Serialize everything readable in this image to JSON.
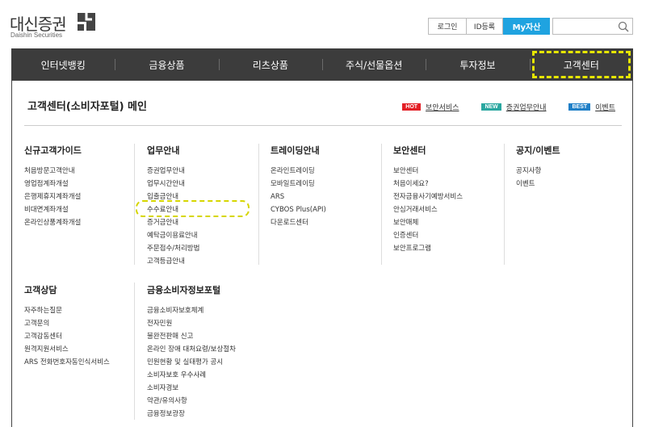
{
  "header": {
    "logo_ko": "대신증권",
    "logo_en": "Daishin Securities",
    "login": "로그인",
    "id_register": "ID등록",
    "my_assets": "My자산"
  },
  "nav": [
    "인터넷뱅킹",
    "금융상품",
    "리츠상품",
    "주식/선물옵션",
    "투자정보",
    "고객센터"
  ],
  "page": {
    "title": "고객센터(소비자포털) 메인",
    "links": [
      {
        "badge": "HOT",
        "text": "보안서비스"
      },
      {
        "badge": "NEW",
        "text": "증권업무안내"
      },
      {
        "badge": "BEST",
        "text": "이벤트"
      }
    ]
  },
  "menus": {
    "new_customer": {
      "title": "신규고객가이드",
      "items": [
        "처음방문고객안내",
        "영업점계좌개설",
        "은행제휴지계좌개설",
        "비대면계좌개설",
        "온라인상품계좌개설"
      ]
    },
    "business": {
      "title": "업무안내",
      "items": [
        "증권업무안내",
        "업무시간안내",
        "입출금안내",
        "수수료안내",
        "증거금안내",
        "예탁금이용료안내",
        "주문접수/처리방법",
        "고객등급안내"
      ]
    },
    "trading": {
      "title": "트레이딩안내",
      "items": [
        "온라인트레이딩",
        "모바일트레이딩",
        "ARS",
        "CYBOS Plus(API)",
        "다운로드센터"
      ]
    },
    "security": {
      "title": "보안센터",
      "items": [
        "보안센터",
        "처음이세요?",
        "전자금융사기예방서비스",
        "안심거래서비스",
        "보안매체",
        "인증센터",
        "보안프로그램"
      ]
    },
    "notice": {
      "title": "공지/이벤트",
      "items": [
        "공지사항",
        "이벤트"
      ]
    },
    "consult": {
      "title": "고객상담",
      "items": [
        "자주하는질문",
        "고객문의",
        "고객감동센터",
        "원격지원서비스",
        "ARS 전화번호자동인식서비스"
      ]
    },
    "consumer": {
      "title": "금융소비자정보포털",
      "items": [
        "금융소비자보호체계",
        "전자민원",
        "불완전판매 신고",
        "온라인 장애 대처요령/보상절차",
        "민원현황 및 실태평가 공시",
        "소비자보호 우수사례",
        "소비자경보",
        "약관/유의사항",
        "금융정보광장"
      ]
    }
  }
}
